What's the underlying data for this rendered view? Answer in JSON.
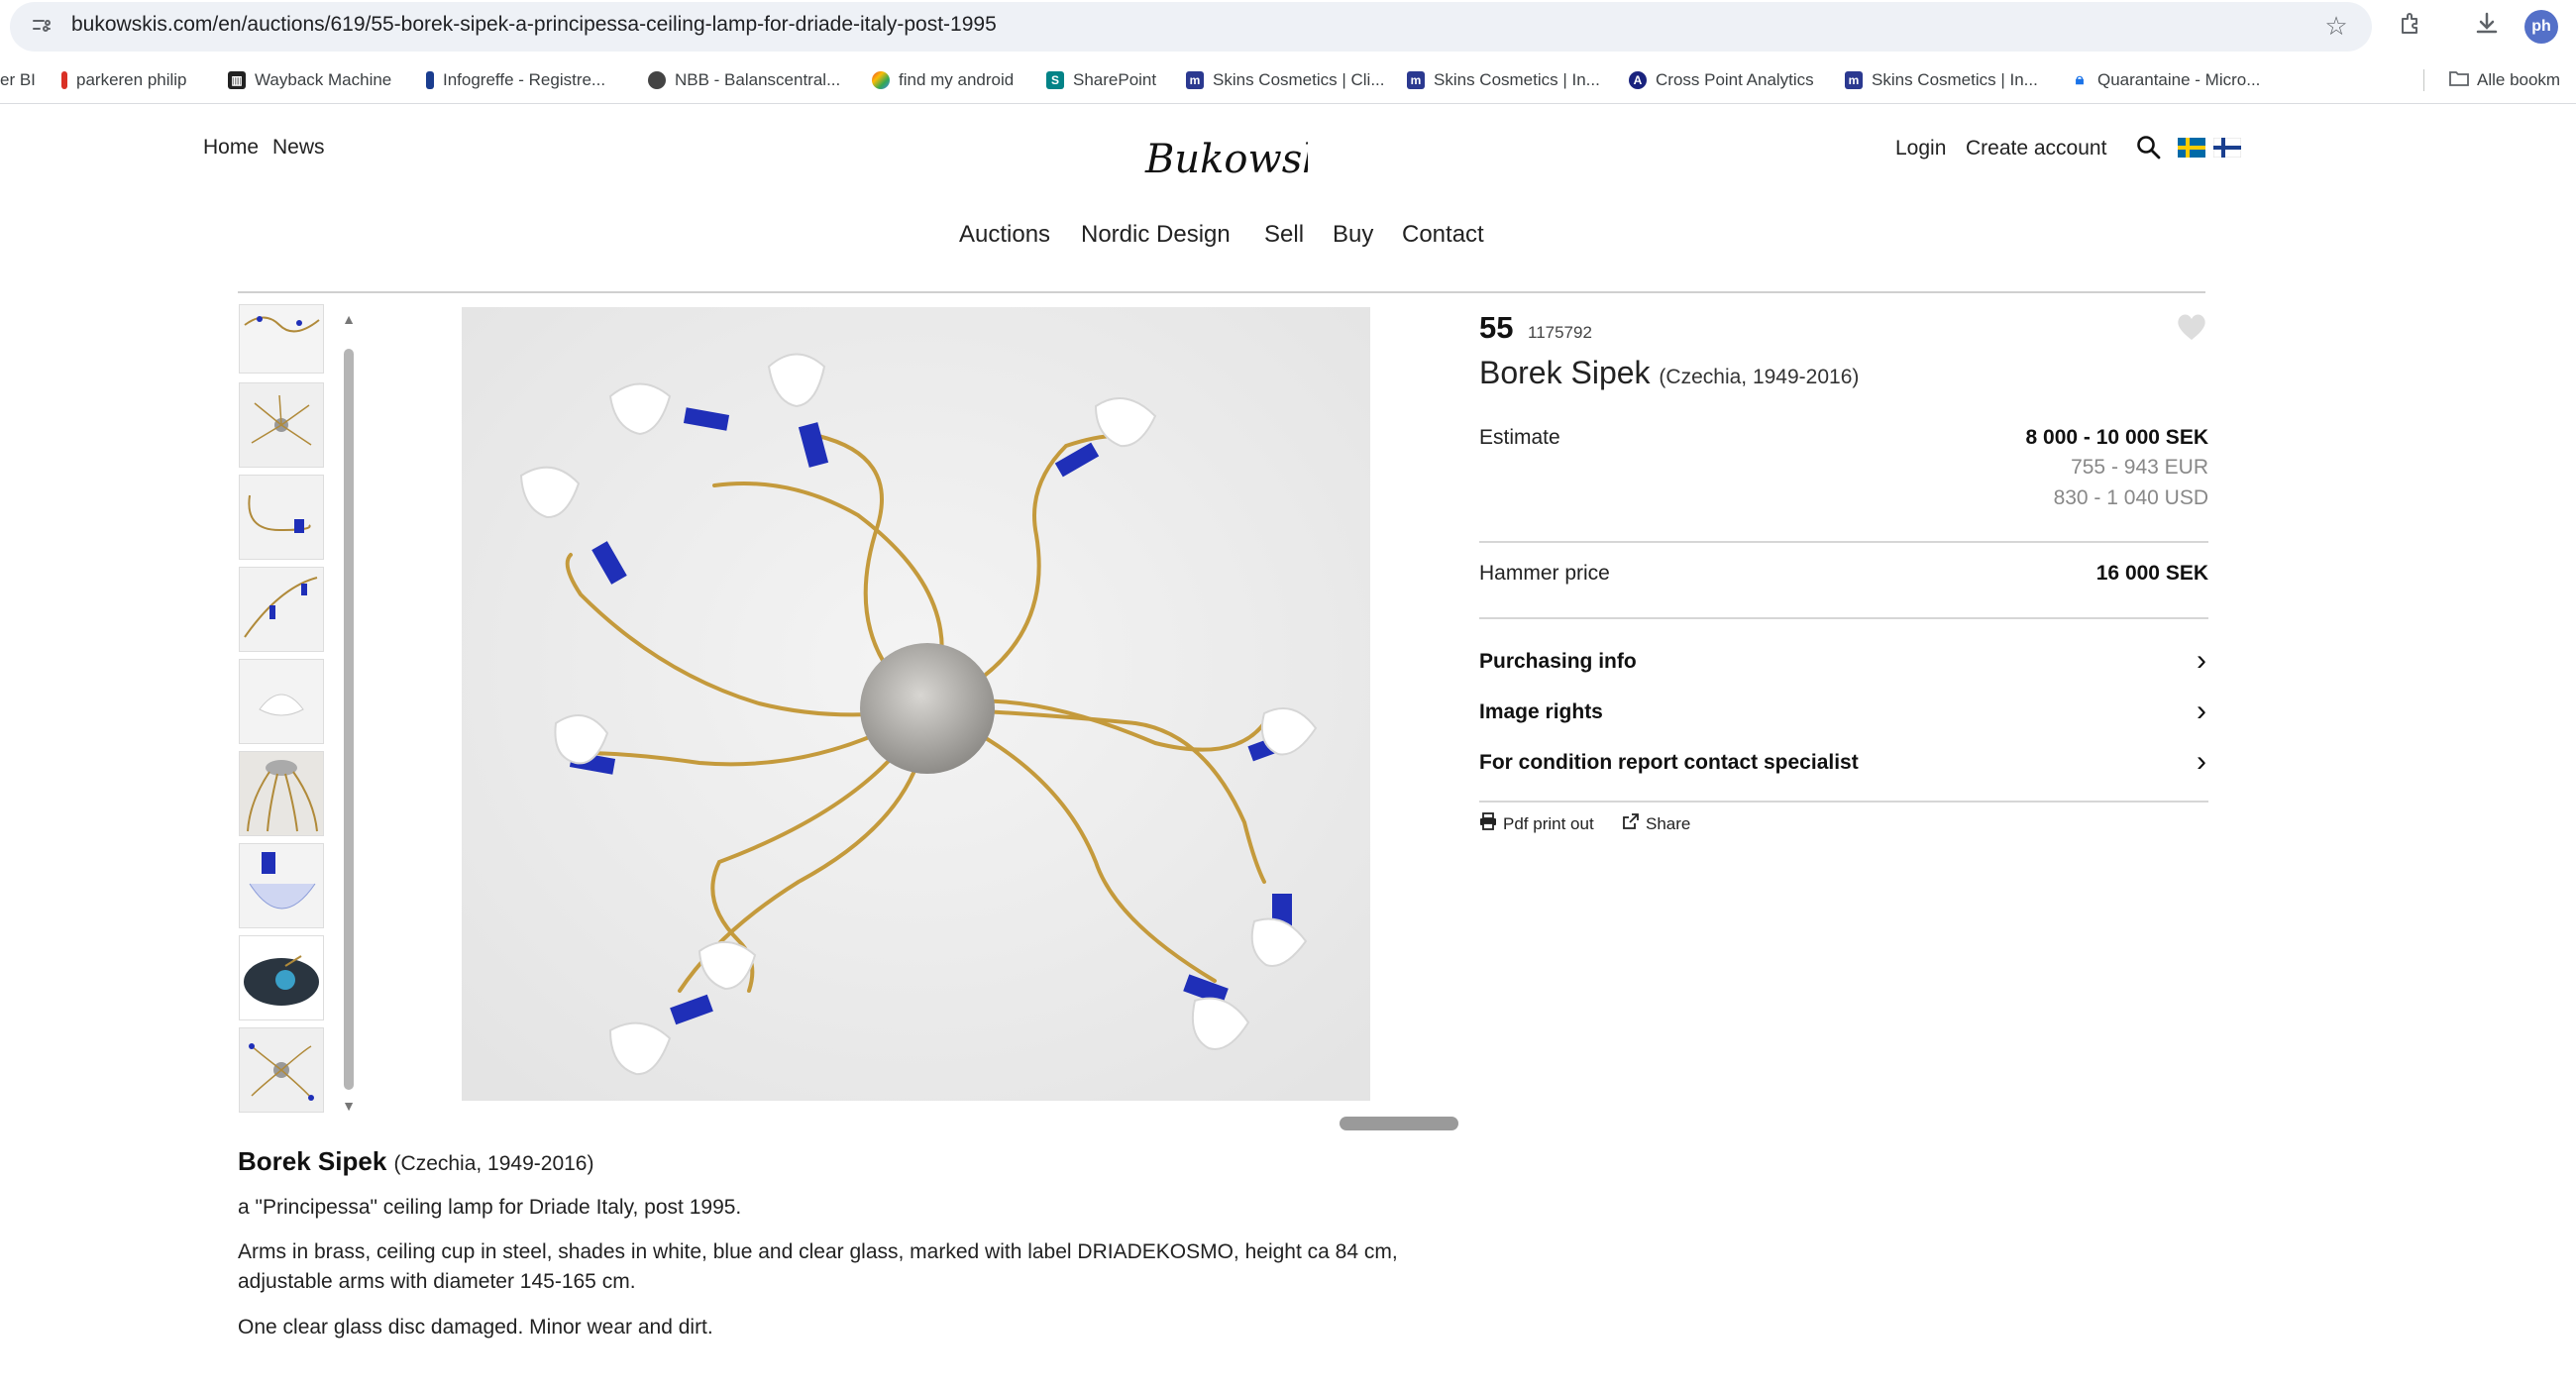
{
  "browser": {
    "url": "bukowskis.com/en/auctions/619/55-borek-sipek-a-principessa-ceiling-lamp-for-driade-italy-post-1995",
    "profile_initials": "ph"
  },
  "bookmarks": [
    {
      "label": "er BI",
      "icon_color": "#ffffff"
    },
    {
      "label": "parkeren philip",
      "icon_color": "#d93025"
    },
    {
      "label": "Wayback Machine",
      "icon_color": "#222222"
    },
    {
      "label": "Infogreffe - Registre...",
      "icon_color": "#1a3d8f"
    },
    {
      "label": "NBB - Balanscentral...",
      "icon_color": "#444444"
    },
    {
      "label": "find my android",
      "icon_color": "#34a853"
    },
    {
      "label": "SharePoint",
      "icon_color": "#038387"
    },
    {
      "label": "Skins Cosmetics | Cli...",
      "icon_color": "#2b3990"
    },
    {
      "label": "Skins Cosmetics | In...",
      "icon_color": "#2b3990"
    },
    {
      "label": "Cross Point Analytics",
      "icon_color": "#1a237e"
    },
    {
      "label": "Skins Cosmetics | In...",
      "icon_color": "#2b3990"
    },
    {
      "label": "Quarantaine - Micro...",
      "icon_color": "#1a73e8"
    }
  ],
  "bookmarks_folder": "Alle bookm",
  "header": {
    "left_links": [
      "Home",
      "News"
    ],
    "logo_text": "Bukowskis",
    "login": "Login",
    "create_account": "Create account",
    "main_nav": [
      "Auctions",
      "Nordic Design",
      "Sell",
      "Buy",
      "Contact"
    ]
  },
  "lot": {
    "number": "55",
    "id": "1175792",
    "artist": "Borek Sipek",
    "artist_meta": "(Czechia, 1949-2016)",
    "estimate_label": "Estimate",
    "estimate_sek": "8 000 - 10 000 SEK",
    "estimate_eur": "755 - 943 EUR",
    "estimate_usd": "830 - 1 040 USD",
    "hammer_label": "Hammer price",
    "hammer_value": "16 000 SEK",
    "accordions": [
      "Purchasing info",
      "Image rights",
      "For condition report contact specialist"
    ],
    "pdf_label": "Pdf print out",
    "share_label": "Share"
  },
  "description": {
    "title": "Borek Sipek",
    "title_meta": "(Czechia, 1949-2016)",
    "subtitle": "a \"Principessa\" ceiling lamp for Driade Italy, post 1995.",
    "details": "Arms in brass, ceiling cup in steel, shades in white, blue and clear glass, marked with label DRIADEKOSMO, height ca 84 cm, adjustable arms with diameter 145-165 cm.",
    "condition": "One clear glass disc damaged. Minor wear and dirt."
  },
  "colors": {
    "accent_blue": "#1f2fb8",
    "brass": "#c49a3c"
  }
}
